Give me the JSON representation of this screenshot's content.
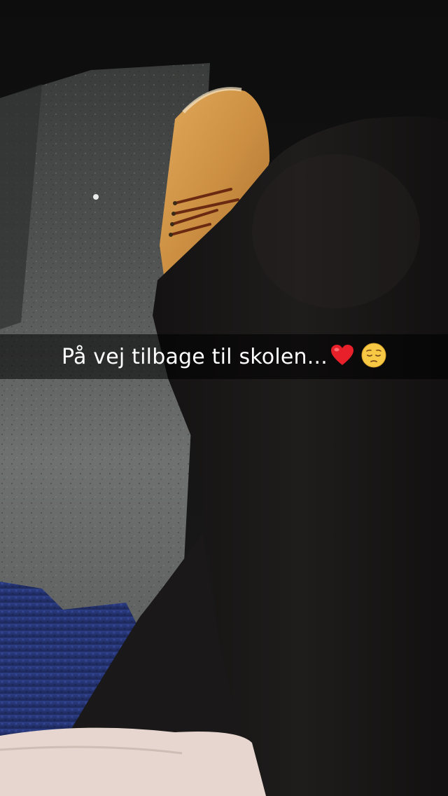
{
  "caption": {
    "text": "På vej tilbage til skolen...",
    "emojis": [
      "red-heart-emoji",
      "pensive-face-emoji"
    ]
  },
  "colors": {
    "boot": "#d39a44",
    "leggings": "#151313",
    "train_floor": "#5a5c5b",
    "seat": "#25336e",
    "caption_bar": "rgba(0,0,0,0.55)"
  }
}
